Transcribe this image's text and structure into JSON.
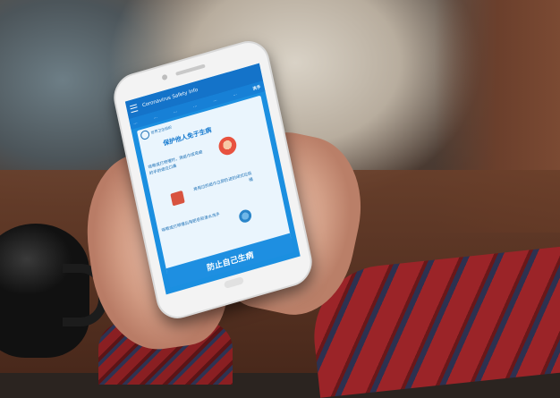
{
  "app": {
    "title": "Coronavirus Safety Info"
  },
  "tabs": {
    "items": [
      "…",
      "…",
      "…",
      "…",
      "…",
      "…",
      "洗手"
    ]
  },
  "poster": {
    "who_caption": "世界卫生组织",
    "headline": "保护他人免于生病",
    "line1": "咳嗽或打喷嚏时，用纸巾或弯曲的手肘遮住口鼻",
    "line2": "将用过的纸巾立即扔进封闭式垃圾桶",
    "line3": "咳嗽或打喷嚏后用肥皂和清水洗手",
    "footer": "防止自己生病"
  }
}
